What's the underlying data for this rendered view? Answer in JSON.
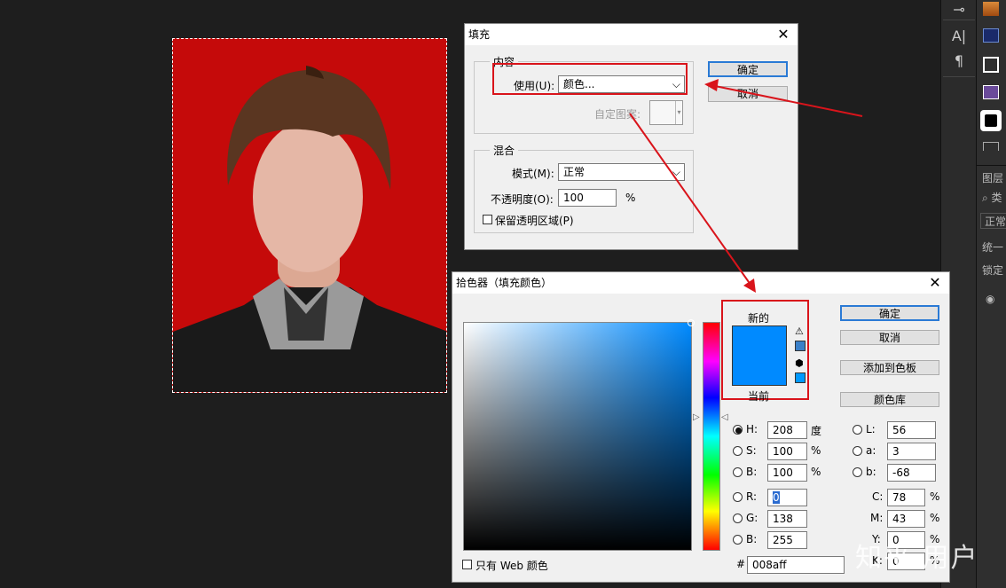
{
  "right_panel": {
    "icons": [
      "brush-tool-icon",
      "type-tool-icon",
      "paragraph-icon"
    ],
    "layers_label": "图层",
    "search_label": "类",
    "blend_value": "正常",
    "unify_label": "统一",
    "lock_label": "锁定"
  },
  "fill_dialog": {
    "title": "填充",
    "content_group": "内容",
    "use_label": "使用(U):",
    "use_value": "颜色...",
    "custom_pattern_label": "自定图案:",
    "blend_group": "混合",
    "mode_label": "模式(M):",
    "mode_value": "正常",
    "opacity_label": "不透明度(O):",
    "opacity_value": "100",
    "opacity_unit": "%",
    "preserve_label": "保留透明区域(P)",
    "ok_label": "确定",
    "cancel_label": "取消"
  },
  "color_picker": {
    "title": "拾色器（填充颜色）",
    "new_label": "新的",
    "current_label": "当前",
    "ok_label": "确定",
    "cancel_label": "取消",
    "add_swatch_label": "添加到色板",
    "libraries_label": "颜色库",
    "web_only_label": "只有 Web 颜色",
    "new_color": "#008aff",
    "fields": {
      "H": {
        "label": "H:",
        "value": "208",
        "unit": "度"
      },
      "S": {
        "label": "S:",
        "value": "100",
        "unit": "%"
      },
      "B": {
        "label": "B:",
        "value": "100",
        "unit": "%"
      },
      "R": {
        "label": "R:",
        "value": "0"
      },
      "G": {
        "label": "G:",
        "value": "138"
      },
      "Bb": {
        "label": "B:",
        "value": "255"
      },
      "L": {
        "label": "L:",
        "value": "56"
      },
      "a": {
        "label": "a:",
        "value": "3"
      },
      "b": {
        "label": "b:",
        "value": "-68"
      },
      "C": {
        "label": "C:",
        "value": "78",
        "unit": "%"
      },
      "M": {
        "label": "M:",
        "value": "43",
        "unit": "%"
      },
      "Y": {
        "label": "Y:",
        "value": "0",
        "unit": "%"
      },
      "K": {
        "label": "K:",
        "value": "0",
        "unit": "%"
      }
    },
    "hex_label": "#",
    "hex_value": "008aff"
  },
  "watermark": "知乎 用户",
  "colors": {
    "accent_red": "#d9141b",
    "photo_bg": "#c50a0a",
    "blue": "#008aff"
  }
}
